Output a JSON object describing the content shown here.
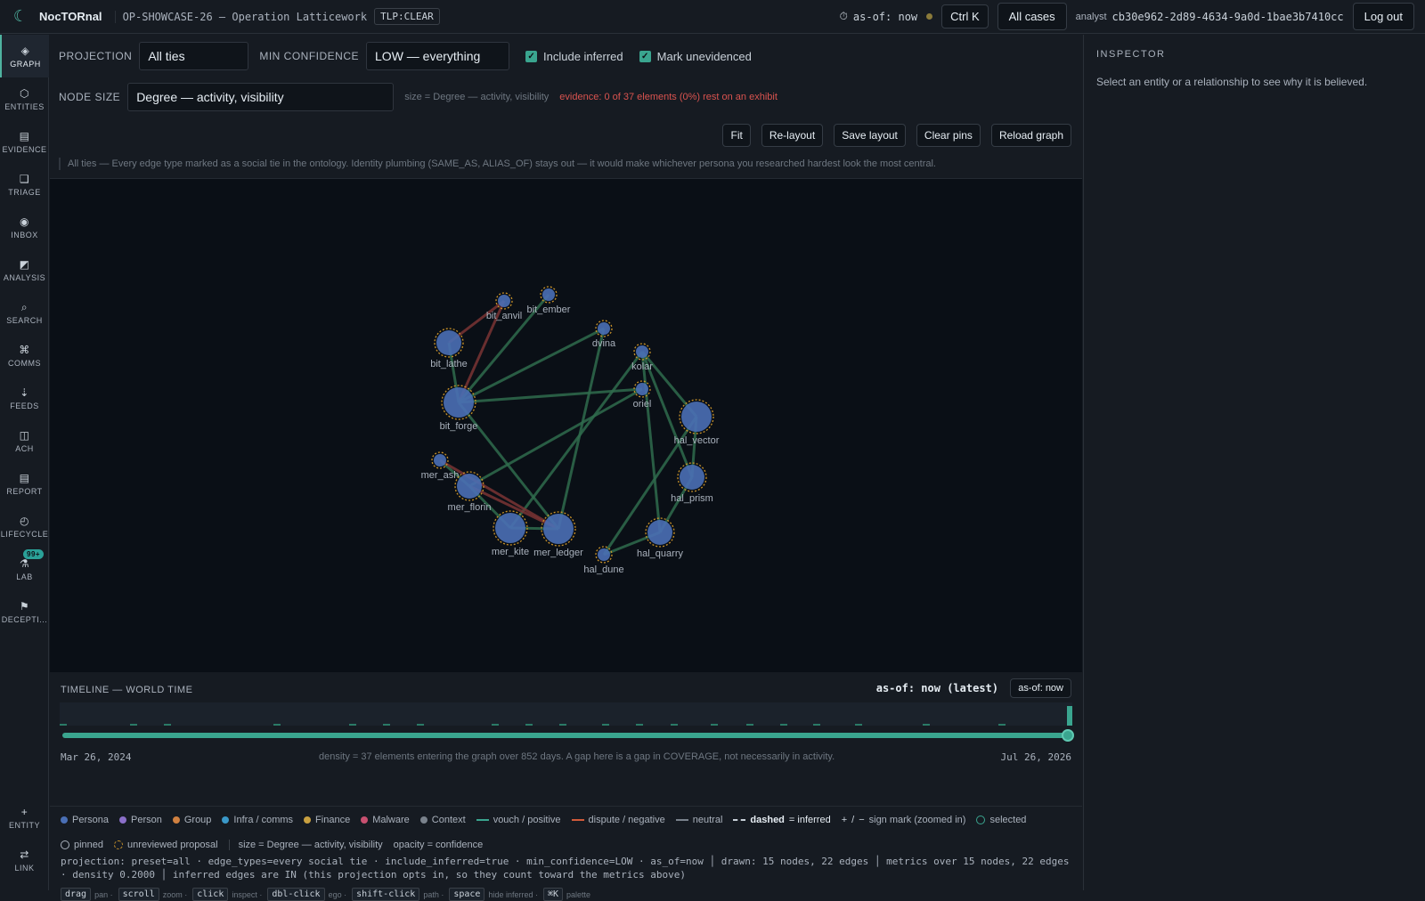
{
  "topbar": {
    "brand": "NocTORnal",
    "case_id": "OP-SHOWCASE-26 — Operation Latticework",
    "tlp": "TLP:CLEAR",
    "asof_label": "as-of: now",
    "shortcut": "Ctrl K",
    "all_cases": "All cases",
    "analyst_label": "analyst",
    "analyst_id": "cb30e962-2d89-4634-9a0d-1bae3b7410cc",
    "logout": "Log out"
  },
  "nav": {
    "items": [
      {
        "label": "GRAPH",
        "icon": "◈"
      },
      {
        "label": "ENTITIES",
        "icon": "⬡"
      },
      {
        "label": "EVIDENCE",
        "icon": "▤"
      },
      {
        "label": "TRIAGE",
        "icon": "❑"
      },
      {
        "label": "INBOX",
        "icon": "◉"
      },
      {
        "label": "ANALYSIS",
        "icon": "◩"
      },
      {
        "label": "SEARCH",
        "icon": "⌕"
      },
      {
        "label": "COMMS",
        "icon": "⌘"
      },
      {
        "label": "FEEDS",
        "icon": "⇣"
      },
      {
        "label": "ACH",
        "icon": "◫"
      },
      {
        "label": "REPORT",
        "icon": "▤"
      },
      {
        "label": "LIFECYCLE",
        "icon": "◴"
      },
      {
        "label": "LAB",
        "icon": "⚗",
        "badge": "99+"
      },
      {
        "label": "DECEPTI...",
        "icon": "⚑"
      }
    ],
    "bottom": [
      {
        "label": "ENTITY",
        "icon": "+"
      },
      {
        "label": "LINK",
        "icon": "⇄"
      }
    ]
  },
  "controls": {
    "projection_label": "PROJECTION",
    "projection_value": "All ties",
    "min_conf_label": "MIN CONFIDENCE",
    "min_conf_value": "LOW — everything",
    "include_inferred": "Include inferred",
    "mark_unevidenced": "Mark unevidenced",
    "node_size_label": "NODE SIZE",
    "node_size_value": "Degree — activity, visibility",
    "size_note": "size = Degree — activity, visibility",
    "evidence_note": "evidence: 0 of 37 elements (0%) rest on an exhibit",
    "buttons": {
      "fit": "Fit",
      "relayout": "Re-layout",
      "save_layout": "Save layout",
      "clear_pins": "Clear pins",
      "reload": "Reload graph"
    },
    "projection_desc": "All ties — Every edge type marked as a social tie in the ontology. Identity plumbing (SAME_AS, ALIAS_OF) stays out — it would make whichever persona you researched hardest look the most central."
  },
  "graph": {
    "colors": {
      "node": "#4a6fb5",
      "ring": "#c8922a",
      "vouch": "#2f6b4c",
      "dispute": "#7a3434"
    },
    "nodes": [
      {
        "id": "bit_anvil",
        "label": "bit_anvil"
      },
      {
        "id": "bit_ember",
        "label": "bit_ember"
      },
      {
        "id": "bit_lathe",
        "label": "bit_lathe"
      },
      {
        "id": "bit_forge",
        "label": "bit_forge"
      },
      {
        "id": "dvina",
        "label": "dvina"
      },
      {
        "id": "kolar",
        "label": "kolar"
      },
      {
        "id": "oriel",
        "label": "oriel"
      },
      {
        "id": "hal_vector",
        "label": "hal_vector"
      },
      {
        "id": "hal_prism",
        "label": "hal_prism"
      },
      {
        "id": "hal_quarry",
        "label": "hal_quarry"
      },
      {
        "id": "hal_dune",
        "label": "hal_dune"
      },
      {
        "id": "mer_ash",
        "label": "mer_ash"
      },
      {
        "id": "mer_florin",
        "label": "mer_florin"
      },
      {
        "id": "mer_kite",
        "label": "mer_kite"
      },
      {
        "id": "mer_ledger",
        "label": "mer_ledger"
      }
    ],
    "edges": [
      {
        "from": "bit_lathe",
        "to": "bit_anvil",
        "kind": "dispute"
      },
      {
        "from": "bit_forge",
        "to": "bit_anvil",
        "kind": "dispute"
      },
      {
        "from": "bit_lathe",
        "to": "bit_forge",
        "kind": "vouch"
      },
      {
        "from": "bit_forge",
        "to": "bit_ember",
        "kind": "vouch"
      },
      {
        "from": "bit_forge",
        "to": "oriel",
        "kind": "vouch"
      },
      {
        "from": "dvina",
        "to": "mer_ledger",
        "kind": "vouch"
      },
      {
        "from": "kolar",
        "to": "hal_vector",
        "kind": "vouch"
      },
      {
        "from": "kolar",
        "to": "hal_prism",
        "kind": "vouch"
      },
      {
        "from": "kolar",
        "to": "hal_quarry",
        "kind": "vouch"
      },
      {
        "from": "kolar",
        "to": "mer_kite",
        "kind": "vouch"
      },
      {
        "from": "oriel",
        "to": "mer_florin",
        "kind": "vouch"
      },
      {
        "from": "hal_vector",
        "to": "hal_prism",
        "kind": "vouch"
      },
      {
        "from": "hal_vector",
        "to": "hal_dune",
        "kind": "vouch"
      },
      {
        "from": "hal_prism",
        "to": "hal_quarry",
        "kind": "vouch"
      },
      {
        "from": "hal_quarry",
        "to": "hal_dune",
        "kind": "vouch"
      },
      {
        "from": "mer_ash",
        "to": "mer_florin",
        "kind": "vouch"
      },
      {
        "from": "mer_ash",
        "to": "mer_ledger",
        "kind": "dispute"
      },
      {
        "from": "mer_florin",
        "to": "mer_ledger",
        "kind": "dispute"
      },
      {
        "from": "mer_florin",
        "to": "mer_kite",
        "kind": "vouch"
      },
      {
        "from": "mer_kite",
        "to": "mer_ledger",
        "kind": "vouch"
      },
      {
        "from": "mer_ledger",
        "to": "bit_forge",
        "kind": "vouch"
      },
      {
        "from": "dvina",
        "to": "bit_forge",
        "kind": "vouch"
      }
    ]
  },
  "timeline": {
    "title": "TIMELINE — WORLD TIME",
    "asof": "as-of: now (latest)",
    "asof_button": "as-of: now",
    "start": "Mar 26, 2024",
    "end": "Jul 26, 2026",
    "density": "density = 37 elements entering the graph over 852 days. A gap here is a gap in COVERAGE, not necessarily in activity."
  },
  "legend": {
    "node_types": [
      {
        "label": "Persona",
        "color": "#4a6fb5"
      },
      {
        "label": "Person",
        "color": "#8b6fc9"
      },
      {
        "label": "Group",
        "color": "#d08040"
      },
      {
        "label": "Infra / comms",
        "color": "#3a98c8"
      },
      {
        "label": "Finance",
        "color": "#c8a040"
      },
      {
        "label": "Malware",
        "color": "#c85070"
      },
      {
        "label": "Context",
        "color": "#7a828c"
      }
    ],
    "vouch": "vouch / positive",
    "dispute": "dispute / negative",
    "neutral": "neutral",
    "dashed_prefix": "dashed",
    "dashed_suffix": "= inferred",
    "sign_mark_plus": "+",
    "sign_mark_sep": "/",
    "sign_mark_minus": "−",
    "sign_mark": "sign mark (zoomed in)",
    "selected": "selected",
    "pinned": "pinned",
    "unreviewed": "unreviewed proposal",
    "size_note": "size = Degree — activity, visibility",
    "opacity_note": "opacity = confidence",
    "projection_line": "projection: preset=all · edge_types=every social tie · include_inferred=true · min_confidence=LOW · as_of=now │ drawn: 15 nodes, 22 edges │ metrics over 15 nodes, 22 edges · density 0.2000 │ inferred edges are IN (this projection opts in, so they count toward the metrics above)",
    "keys": [
      {
        "key": "drag",
        "desc": "pan ·"
      },
      {
        "key": "scroll",
        "desc": "zoom ·"
      },
      {
        "key": "click",
        "desc": "inspect ·"
      },
      {
        "key": "dbl-click",
        "desc": "ego ·"
      },
      {
        "key": "shift-click",
        "desc": "path ·"
      },
      {
        "key": "space",
        "desc": "hide inferred ·"
      },
      {
        "key": "⌘K",
        "desc": "palette"
      }
    ]
  },
  "inspector": {
    "title": "INSPECTOR",
    "hint": "Select an entity or a relationship to see why it is believed."
  }
}
